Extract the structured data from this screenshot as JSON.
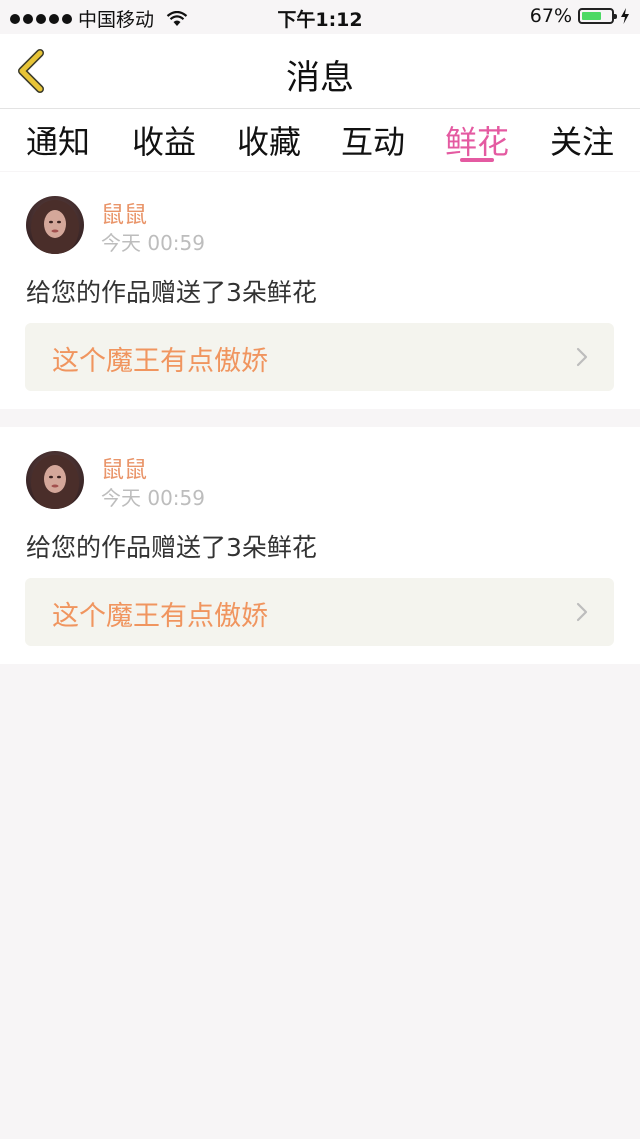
{
  "status_bar": {
    "carrier": "中国移动",
    "time": "下午1:12",
    "battery_percent": "67%",
    "battery_level": 0.67
  },
  "header": {
    "title": "消息",
    "back_icon": "back-chevron-icon"
  },
  "tabs": [
    {
      "label": "通知",
      "active": false
    },
    {
      "label": "收益",
      "active": false
    },
    {
      "label": "收藏",
      "active": false
    },
    {
      "label": "互动",
      "active": false
    },
    {
      "label": "鲜花",
      "active": true
    },
    {
      "label": "关注",
      "active": false
    }
  ],
  "messages": [
    {
      "username": "鼠鼠",
      "time": "今天 00:59",
      "text": "给您的作品赠送了3朵鲜花",
      "work_title": "这个魔王有点傲娇"
    },
    {
      "username": "鼠鼠",
      "time": "今天 00:59",
      "text": "给您的作品赠送了3朵鲜花",
      "work_title": "这个魔王有点傲娇"
    }
  ],
  "colors": {
    "accent_pink": "#e45aa1",
    "username_orange": "#e9956a",
    "work_title_orange": "#f0955f",
    "back_icon_yellow": "#e7c437"
  }
}
